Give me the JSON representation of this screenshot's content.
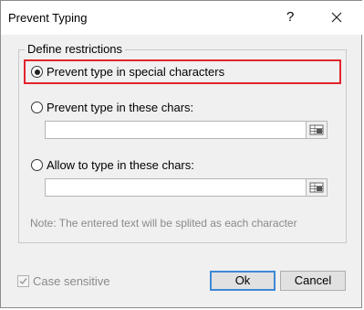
{
  "window": {
    "title": "Prevent Typing",
    "help_label": "?",
    "close_icon": "close-icon"
  },
  "group": {
    "label": "Define restrictions"
  },
  "options": [
    {
      "label": "Prevent type in special characters",
      "selected": true
    },
    {
      "label": "Prevent type in these chars:",
      "selected": false,
      "value": ""
    },
    {
      "label": "Allow to type in these chars:",
      "selected": false,
      "value": ""
    }
  ],
  "note": "Note: The entered text will be splited as each character",
  "case_sensitive": {
    "label": "Case sensitive",
    "checked": true,
    "disabled": true
  },
  "buttons": {
    "ok": "Ok",
    "cancel": "Cancel"
  },
  "colors": {
    "highlight": "#e3232b",
    "primary_border": "#3f88d6",
    "disabled_text": "#8a8a8a"
  }
}
